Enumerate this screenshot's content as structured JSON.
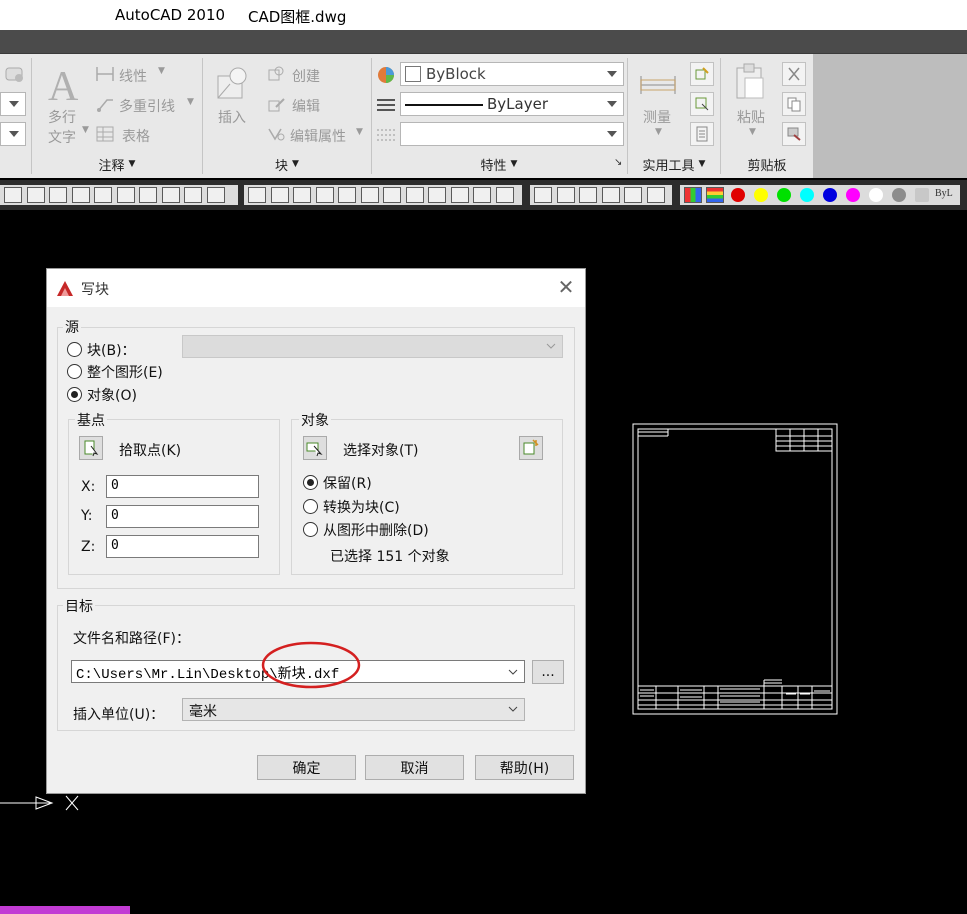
{
  "titlebar": {
    "app": "AutoCAD 2010",
    "file": "CAD图框.dwg"
  },
  "ribbon": {
    "annotation": {
      "big_text_label": "多行",
      "big_text_label2": "文字",
      "linear": "线性",
      "multileader": "多重引线",
      "table": "表格",
      "title": "注释"
    },
    "block": {
      "insert": "插入",
      "create": "创建",
      "edit": "编辑",
      "edit_attr": "编辑属性",
      "title": "块"
    },
    "properties": {
      "color": "ByBlock",
      "linetype": "ByLayer",
      "title": "特性"
    },
    "utilities": {
      "measure": "测量",
      "title": "实用工具"
    },
    "clipboard": {
      "paste": "粘贴",
      "title": "剪贴板"
    }
  },
  "toolbar": {
    "swatches": [
      "#e00000",
      "#ffff00",
      "#00e000",
      "#00ffff",
      "#0000e0",
      "#ff00ff",
      "#ffffff",
      "#8c8c8c",
      "#c8c8c8"
    ],
    "bylayer_short": "ByL"
  },
  "dialog": {
    "title": "写块",
    "source": {
      "label": "源",
      "opt_block": "块(B)：",
      "opt_whole": "整个图形(E)",
      "opt_objects": "对象(O)"
    },
    "basepoint": {
      "label": "基点",
      "pick": "拾取点(K)",
      "x_label": "X:",
      "y_label": "Y:",
      "z_label": "Z:",
      "x": "0",
      "y": "0",
      "z": "0"
    },
    "objects": {
      "label": "对象",
      "select": "选择对象(T)",
      "retain": "保留(R)",
      "convert": "转换为块(C)",
      "delete": "从图形中删除(D)",
      "status": "已选择 151 个对象"
    },
    "destination": {
      "label": "目标",
      "path_label": "文件名和路径(F)：",
      "path_value": "C:\\Users\\Mr.Lin\\Desktop\\新块.dxf",
      "browse": "...",
      "units_label": "插入单位(U)：",
      "units_value": "毫米"
    },
    "buttons": {
      "ok": "确定",
      "cancel": "取消",
      "help": "帮助(H)"
    }
  },
  "canvas": {
    "ucs_x": "X"
  },
  "colors": {
    "accent_red": "#d42020"
  }
}
